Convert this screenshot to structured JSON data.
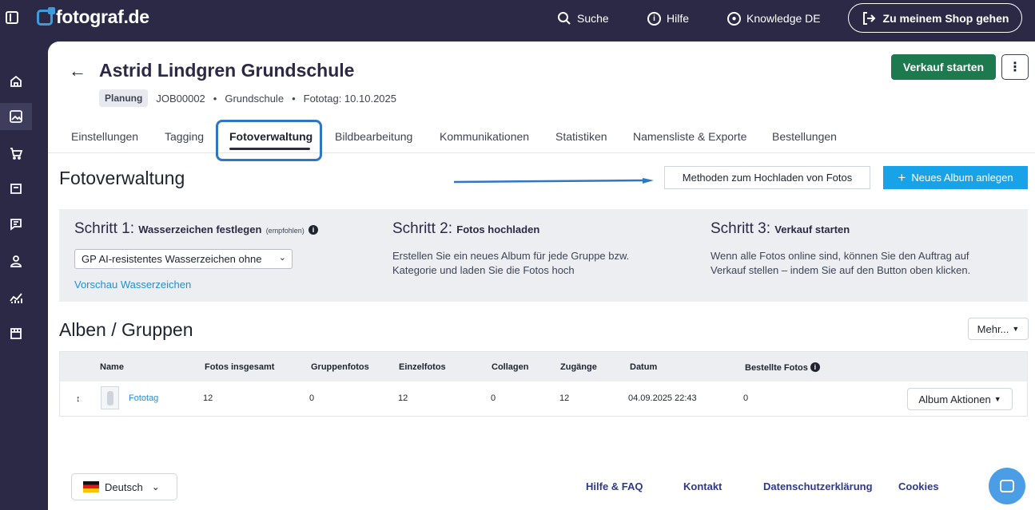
{
  "brand": {
    "name": "fotograf.de"
  },
  "topnav": {
    "search": "Suche",
    "help": "Hilfe",
    "knowledge": "Knowledge DE",
    "shop_button": "Zu meinem Shop gehen"
  },
  "job": {
    "title": "Astrid Lindgren Grundschule",
    "status_badge": "Planung",
    "id": "JOB00002",
    "sep1": "•",
    "type": "Grundschule",
    "sep2": "•",
    "photo_day": "Fototag: 10.10.2025",
    "start_sale": "Verkauf starten",
    "more": "⋮"
  },
  "tabs": [
    {
      "label": "Einstellungen"
    },
    {
      "label": "Tagging"
    },
    {
      "label": "Fotoverwaltung"
    },
    {
      "label": "Bildbearbeitung"
    },
    {
      "label": "Kommunikationen"
    },
    {
      "label": "Statistiken"
    },
    {
      "label": "Namensliste & Exporte"
    },
    {
      "label": "Bestellungen"
    }
  ],
  "photo_mgmt": {
    "title": "Fotoverwaltung",
    "methods_button": "Methoden zum Hochladen von Fotos",
    "new_album_button": "Neues Album anlegen"
  },
  "steps": [
    {
      "prefix": "Schritt 1:",
      "title": "Wasserzeichen festlegen",
      "note": "(empfohlen)",
      "select_value": "GP AI-resistentes Wasserzeichen ohne",
      "link": "Vorschau Wasserzeichen"
    },
    {
      "prefix": "Schritt 2:",
      "title": "Fotos hochladen",
      "text": "Erstellen Sie ein neues Album für jede Gruppe bzw. Kategorie und laden Sie die Fotos hoch"
    },
    {
      "prefix": "Schritt 3:",
      "title": "Verkauf starten",
      "text": "Wenn alle Fotos online sind, können Sie den Auftrag auf Verkauf stellen – indem Sie auf den Button oben klicken."
    }
  ],
  "albums": {
    "title": "Alben / Gruppen",
    "more_button": "Mehr...",
    "columns": [
      "Name",
      "Fotos insgesamt",
      "Gruppenfotos",
      "Einzelfotos",
      "Collagen",
      "Zugänge",
      "Datum",
      "Bestellte Fotos"
    ],
    "rows": [
      {
        "name": "Fototag",
        "total": "12",
        "group": "0",
        "single": "12",
        "collages": "0",
        "access": "12",
        "date": "04.09.2025 22:43",
        "ordered": "0",
        "actions": "Album Aktionen"
      }
    ]
  },
  "footer": {
    "language": "Deutsch",
    "links": [
      "Hilfe & FAQ",
      "Kontakt",
      "Datenschutzerklärung",
      "Cookies"
    ]
  },
  "colors": {
    "nav_bg": "#2b2945",
    "primary_green": "#1c7a4e",
    "accent_blue": "#18a3e8",
    "highlight_blue": "#2f77c2",
    "link_blue": "#1f8fd6"
  }
}
